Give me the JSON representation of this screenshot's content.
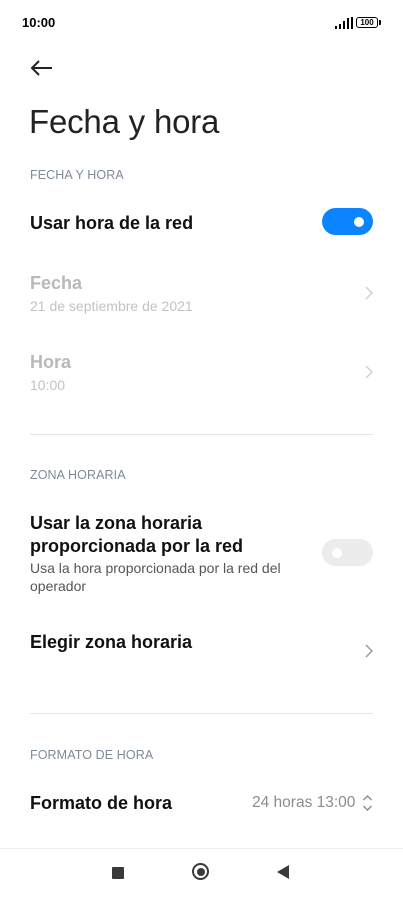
{
  "status_bar": {
    "time": "10:00",
    "battery": "100",
    "icons": [
      "signal-icon",
      "battery-icon"
    ]
  },
  "header": {
    "back_icon": "arrow-left-icon",
    "title": "Fecha y hora"
  },
  "sections": {
    "fecha_y_hora": {
      "header": "FECHA Y HORA",
      "network_time": {
        "label": "Usar hora de la red",
        "enabled": true
      },
      "date": {
        "label": "Fecha",
        "value": "21 de septiembre de 2021"
      },
      "time": {
        "label": "Hora",
        "value": "10:00"
      }
    },
    "zona_horaria": {
      "header": "ZONA HORARIA",
      "network_zone": {
        "label_line1": "Usar la zona horaria",
        "label_line2": "proporcionada por la red",
        "desc_line1": "Usa la hora proporcionada por la red del",
        "desc_line2": "operador",
        "enabled": false
      },
      "choose_zone": {
        "label": "Elegir zona horaria"
      }
    },
    "formato_de_hora": {
      "header": "FORMATO DE HORA",
      "format": {
        "label": "Formato de hora",
        "value": "24 horas 13:00"
      }
    }
  },
  "nav_bar": {
    "icons": [
      "recents-square-icon",
      "home-circle-icon",
      "back-triangle-icon"
    ]
  },
  "colors": {
    "accent": "#0d84ff",
    "section_header": "#7f8a99",
    "disabled_text": "#b9b9b9"
  }
}
